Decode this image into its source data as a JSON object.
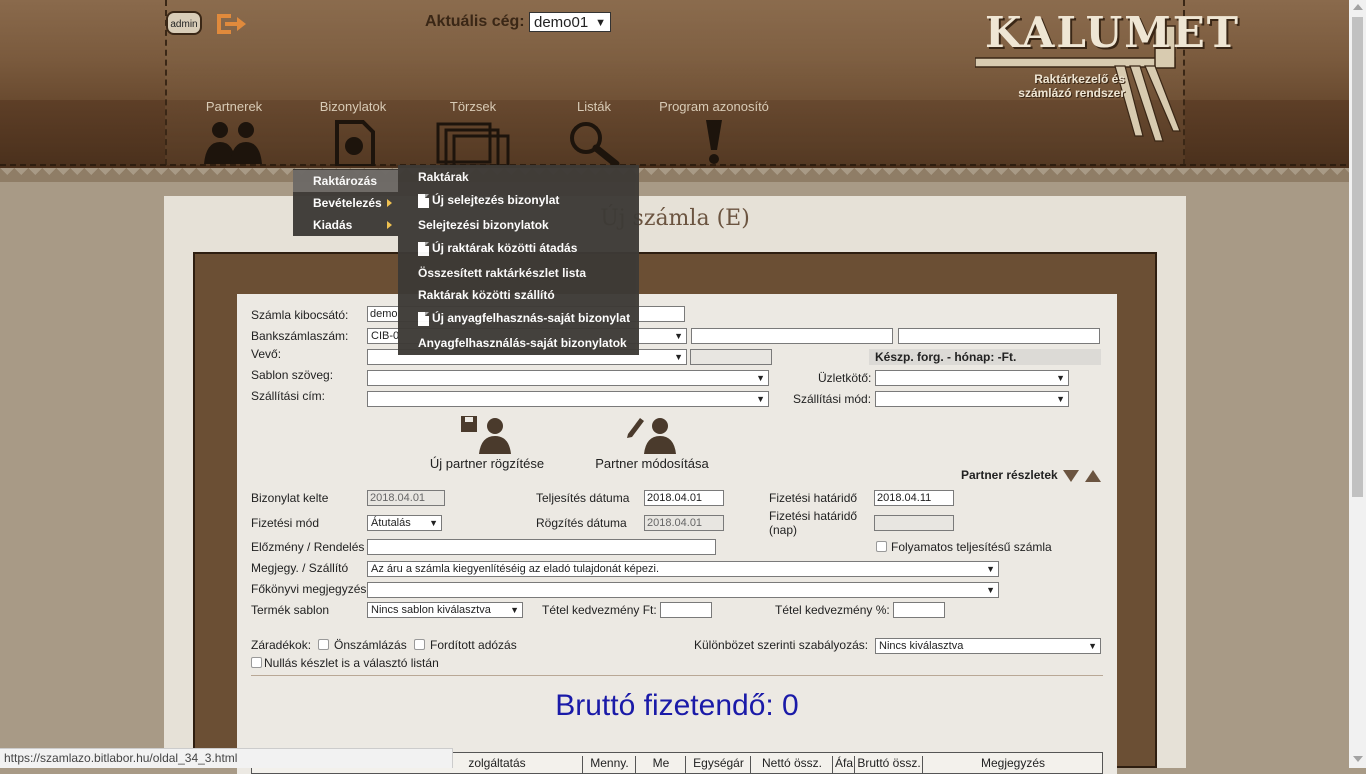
{
  "header": {
    "admin_label": "admin",
    "company_label": "Aktuális cég:",
    "company_value": "demo01",
    "logo_title": "KALUMET",
    "logo_subtitle_1": "Raktárkezelő és",
    "logo_subtitle_2": "számlázó rendszer"
  },
  "nav": {
    "partners": "Partnerek",
    "documents": "Bizonylatok",
    "masters": "Törzsek",
    "lists": "Listák",
    "program_id": "Program azonosító"
  },
  "menu_level1": {
    "items": [
      "Raktározás",
      "Bevételezés",
      "Kiadás"
    ]
  },
  "menu_level2": {
    "items": [
      "Raktárak",
      "Új selejtezés bizonylat",
      "Selejtezési bizonylatok",
      "Új raktárak közötti átadás",
      "Összesített raktárkészlet lista",
      "Raktárak közötti szállító",
      "Új anyagfelhasznás-saját bizonylat",
      "Anyagfelhasználás-saját bizonylatok"
    ]
  },
  "page": {
    "title": "Új számla (E)"
  },
  "form": {
    "issuer_label": "Számla kibocsátó:",
    "issuer_value": "demo",
    "bank_label": "Bankszámlaszám:",
    "bank_value": "CIB-0",
    "buyer_label": "Vevő:",
    "cash_info": "Készp. forg. - hónap: -Ft.",
    "template_text_label": "Sablon szöveg:",
    "agent_label": "Üzletkötő:",
    "ship_addr_label": "Szállítási cím:",
    "ship_mode_label": "Szállítási mód:",
    "new_partner": "Új partner rögzítése",
    "edit_partner": "Partner módosítása",
    "partner_details": "Partner részletek",
    "doc_date_label": "Bizonylat kelte",
    "doc_date": "2018.04.01",
    "fulfil_date_label": "Teljesítés dátuma",
    "fulfil_date": "2018.04.01",
    "due_date_label": "Fizetési határidő",
    "due_date": "2018.04.11",
    "pay_mode_label": "Fizetési mód",
    "pay_mode": "Átutalás",
    "record_date_label": "Rögzítés dátuma",
    "record_date": "2018.04.01",
    "due_days_label_1": "Fizetési határidő",
    "due_days_label_2": "(nap)",
    "prev_order_label": "Előzmény / Rendelés",
    "continuous_label": "Folyamatos teljesítésű számla",
    "note_ship_label": "Megjegy. / Szállító",
    "note_ship_value": "Az áru a számla kiegyenlítéséig az eladó tulajdonát képezi.",
    "ledger_note_label": "Főkönyvi megjegyzés",
    "product_template_label": "Termék sablon",
    "product_template_value": "Nincs sablon kiválasztva",
    "item_discount_ft_label": "Tétel kedvezmény Ft:",
    "item_discount_pct_label": "Tétel kedvezmény %:",
    "clauses_label": "Záradékok:",
    "self_billing_label": "Önszámlázás",
    "reverse_tax_label": "Fordított adózás",
    "diff_rule_label": "Különbözet szerinti szabályozás:",
    "diff_rule_value": "Nincs kiválasztva",
    "zero_stock_label": "Nullás készlet is a választó listán",
    "brutto_text": "Bruttó fizetendő: 0"
  },
  "table": {
    "headers": [
      "zolgáltatás",
      "Menny.",
      "Me",
      "Egységár",
      "Nettó össz.",
      "Áfa",
      "Bruttó össz.",
      "Megjegyzés"
    ]
  },
  "status_url": "https://szamlazo.bitlabor.hu/oldal_34_3.html",
  "colors": {
    "brown_dark": "#4a301c",
    "panel": "#e6e1d7",
    "accent_orange": "#e08a3c",
    "brutto_blue": "#1a1aa8"
  }
}
